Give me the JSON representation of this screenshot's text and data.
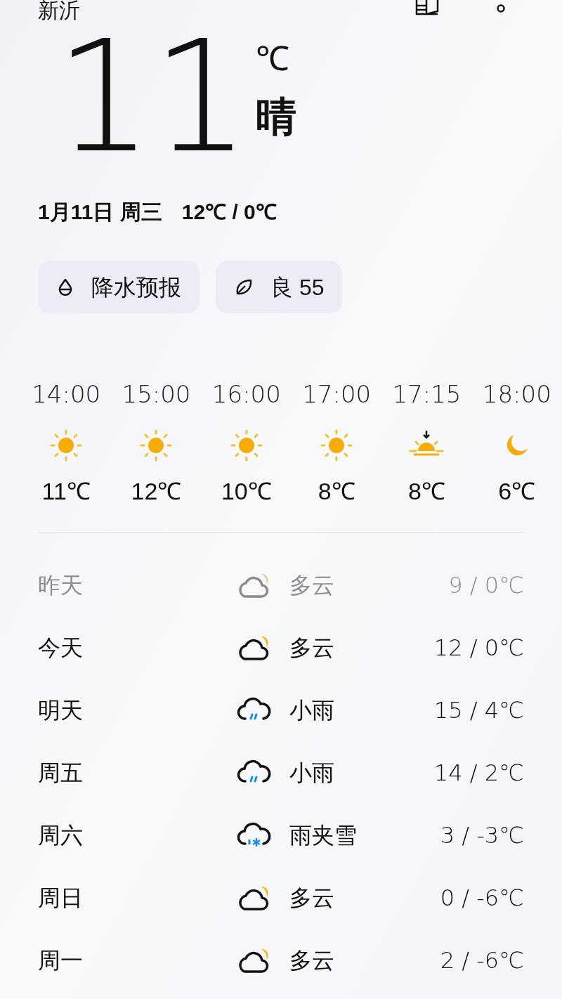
{
  "header": {
    "city": "新沂"
  },
  "current": {
    "temp": "11",
    "unit": "℃",
    "condition": "晴",
    "date": "1月11日 周三",
    "range": "12℃ / 0℃"
  },
  "chips": [
    {
      "kind": "rain",
      "label": "降水预报"
    },
    {
      "kind": "air",
      "label": "良 55"
    }
  ],
  "hourly": [
    {
      "time": "14:00",
      "kind": "sun",
      "temp": "11℃"
    },
    {
      "time": "15:00",
      "kind": "sun",
      "temp": "12℃"
    },
    {
      "time": "16:00",
      "kind": "sun",
      "temp": "10℃"
    },
    {
      "time": "17:00",
      "kind": "sun",
      "temp": "8℃"
    },
    {
      "time": "17:15",
      "kind": "sunset",
      "temp": "8℃"
    },
    {
      "time": "18:00",
      "kind": "moon",
      "temp": "6℃"
    }
  ],
  "daily": [
    {
      "day": "昨天",
      "kind": "cloudy",
      "condition": "多云",
      "range": "9 / 0℃",
      "past": true
    },
    {
      "day": "今天",
      "kind": "cloudy",
      "condition": "多云",
      "range": "12 / 0℃",
      "past": false
    },
    {
      "day": "明天",
      "kind": "rain",
      "condition": "小雨",
      "range": "15 / 4℃",
      "past": false
    },
    {
      "day": "周五",
      "kind": "rain",
      "condition": "小雨",
      "range": "14 / 2℃",
      "past": false
    },
    {
      "day": "周六",
      "kind": "sleet",
      "condition": "雨夹雪",
      "range": "3 / -3℃",
      "past": false
    },
    {
      "day": "周日",
      "kind": "cloudy",
      "condition": "多云",
      "range": "0 / -6℃",
      "past": false
    },
    {
      "day": "周一",
      "kind": "cloudy",
      "condition": "多云",
      "range": "2 / -6℃",
      "past": false
    }
  ]
}
